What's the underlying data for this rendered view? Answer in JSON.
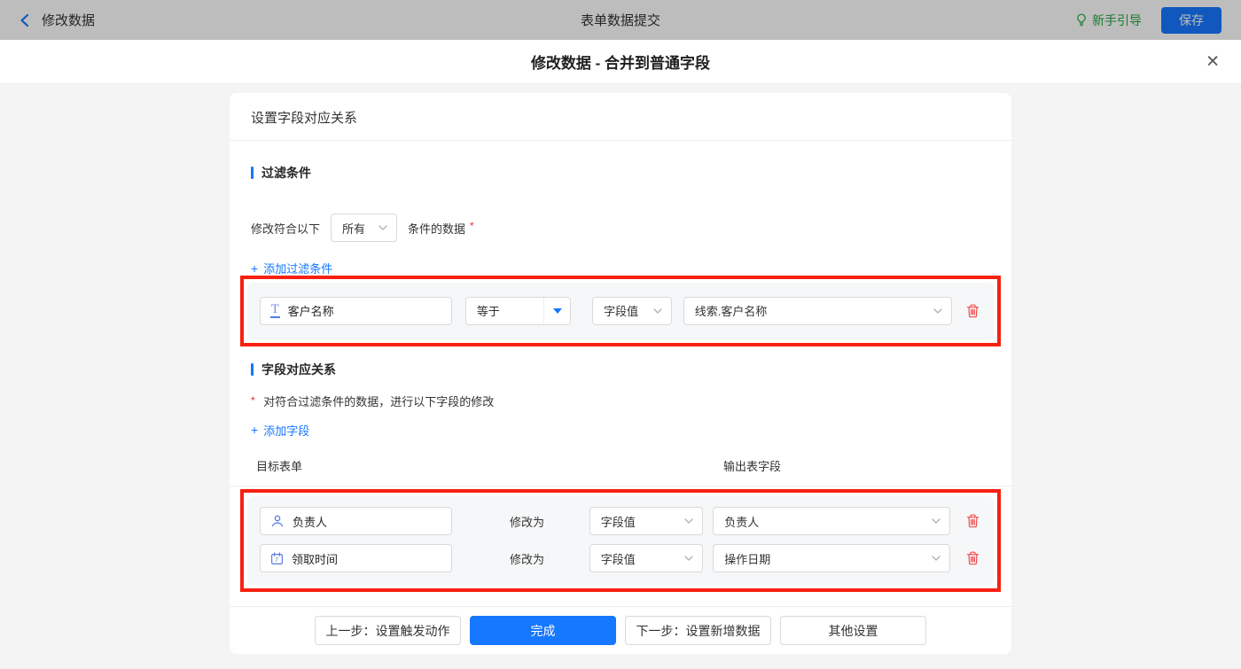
{
  "topbar": {
    "back_label": "修改数据",
    "title": "表单数据提交",
    "guide_label": "新手引导",
    "save_label": "保存"
  },
  "modal": {
    "title": "修改数据 - 合并到普通字段",
    "close_glyph": "✕"
  },
  "card": {
    "header": "设置字段对应关系",
    "filter_section": {
      "title": "过滤条件",
      "prefix": "修改符合以下",
      "match_value": "所有",
      "suffix": "条件的数据",
      "required_mark": "*",
      "add_plus": "+",
      "add_label": "添加过滤条件",
      "row": {
        "field": "客户名称",
        "field_icon_glyph": "T",
        "operator": "等于",
        "value_type": "字段值",
        "value": "线索.客户名称"
      }
    },
    "mapping_section": {
      "title": "字段对应关系",
      "required_mark": "*",
      "description": "对符合过滤条件的数据，进行以下字段的修改",
      "add_plus": "+",
      "add_label": "添加字段",
      "col_left": "目标表单",
      "col_right": "输出表字段",
      "rows": [
        {
          "field": "负责人",
          "action": "修改为",
          "value_type": "字段值",
          "value": "负责人"
        },
        {
          "field": "领取时间",
          "action": "修改为",
          "value_type": "字段值",
          "value": "操作日期"
        }
      ]
    },
    "footer": {
      "prev_label": "上一步：设置触发动作",
      "done_label": "完成",
      "next_label": "下一步：设置新增数据",
      "other_label": "其他设置"
    }
  },
  "icons": [
    "chevron-left",
    "lightbulb",
    "close",
    "text-field",
    "user",
    "calendar",
    "chevron-down",
    "caret-down",
    "trash",
    "plus"
  ],
  "colors": {
    "accent_blue": "#1677ff",
    "link_blue": "#1677ff",
    "highlight_red": "#f82010",
    "trash_red": "#f04b4b",
    "required_red": "#f5222d",
    "guide_green": "#27a63d",
    "panel_gray": "#f6f7f8",
    "page_bg": "#f4f4f5"
  }
}
